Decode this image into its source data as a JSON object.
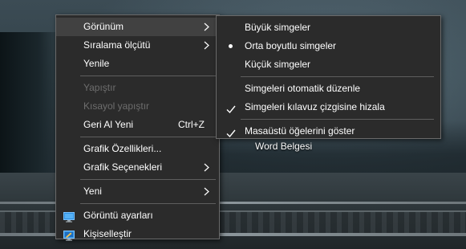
{
  "desktop": {
    "icon_label": "Word Belgesi"
  },
  "context_menu": {
    "items": [
      {
        "label": "Görünüm",
        "has_submenu": true,
        "highlighted": true
      },
      {
        "label": "Sıralama ölçütü",
        "has_submenu": true
      },
      {
        "label": "Yenile"
      },
      {
        "label": "Yapıştır",
        "disabled": true
      },
      {
        "label": "Kısayol yapıştır",
        "disabled": true
      },
      {
        "label": "Geri Al Yeni",
        "shortcut": "Ctrl+Z"
      },
      {
        "label": "Grafik Özellikleri..."
      },
      {
        "label": "Grafik Seçenekleri",
        "has_submenu": true
      },
      {
        "label": "Yeni",
        "has_submenu": true
      },
      {
        "label": "Görüntü ayarları",
        "icon": "display-settings-icon"
      },
      {
        "label": "Kişiselleştir",
        "icon": "personalize-icon"
      }
    ]
  },
  "view_submenu": {
    "items": [
      {
        "label": "Büyük simgeler"
      },
      {
        "label": "Orta boyutlu simgeler",
        "selected": true,
        "marker": "bullet"
      },
      {
        "label": "Küçük simgeler"
      },
      {
        "label": "Simgeleri otomatik düzenle"
      },
      {
        "label": "Simgeleri kılavuz çizgisine hizala",
        "checked": true
      },
      {
        "label": "Masaüstü öğelerini göster",
        "checked": true
      }
    ]
  },
  "colors": {
    "menu_background": "#2b2b2b",
    "menu_highlight": "#414141",
    "menu_border": "#6a6a6a",
    "text": "#ffffff",
    "disabled_text": "#6d6d6d"
  }
}
